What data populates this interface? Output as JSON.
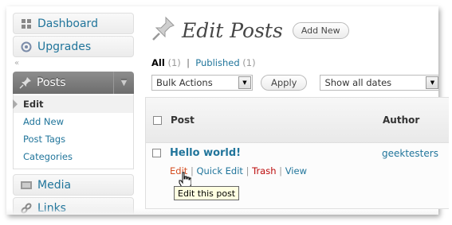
{
  "sidebar": {
    "items": [
      {
        "label": "Dashboard",
        "icon": "dashboard-icon"
      },
      {
        "label": "Upgrades",
        "icon": "upgrades-icon"
      }
    ],
    "posts": {
      "label": "Posts",
      "icon": "pushpin-icon",
      "submenu": [
        "Edit",
        "Add New",
        "Post Tags",
        "Categories"
      ],
      "current": "Edit"
    },
    "after": [
      {
        "label": "Media",
        "icon": "media-icon"
      },
      {
        "label": "Links",
        "icon": "links-icon"
      }
    ]
  },
  "header": {
    "title": "Edit Posts",
    "add_new_label": "Add New"
  },
  "filters": {
    "all_label": "All",
    "all_count": "(1)",
    "separator": "|",
    "published_label": "Published",
    "published_count": "(1)"
  },
  "controls": {
    "bulk_actions": "Bulk Actions",
    "apply_label": "Apply",
    "dates": "Show all dates"
  },
  "table": {
    "columns": [
      "Post",
      "Author"
    ],
    "rows": [
      {
        "title": "Hello world!",
        "author": "geektesters",
        "actions": [
          "Edit",
          "Quick Edit",
          "Trash",
          "View"
        ]
      }
    ]
  },
  "tooltip": "Edit this post",
  "colors": {
    "link": "#21759b",
    "edit_hover": "#d54e21",
    "trash": "#bc0b0b",
    "menu_active": "#7d7d7d"
  }
}
